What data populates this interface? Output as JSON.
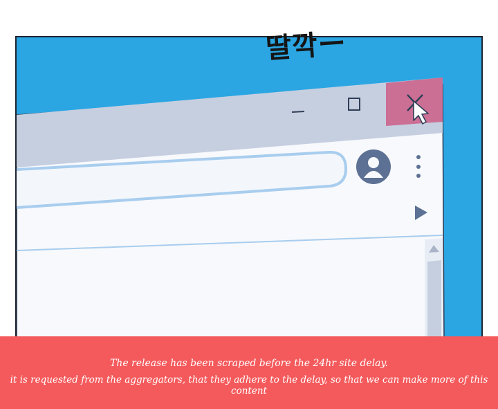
{
  "sound_effect": "딸깍ー",
  "browser": {
    "icons": {
      "minimize": "minimize-icon",
      "maximize": "maximize-icon",
      "close": "close-icon",
      "cursor": "cursor-arrow-icon",
      "profile": "profile-avatar-icon",
      "menu": "kebab-menu-icon",
      "play": "play-triangle-icon",
      "scroll_up": "scroll-up-arrow-icon"
    }
  },
  "colors": {
    "background": "#2ba6e3",
    "title_bar": "#c6cfe0",
    "close_button": "#cc6f95",
    "browser_body": "#f7f9fc",
    "address_border": "#a8cdee",
    "avatar": "#5d7194",
    "banner": "#f45a5c"
  },
  "notice": {
    "line1": "The release has been scraped before the 24hr site delay.",
    "line2": "it is requested from the aggregators, that they adhere to the delay, so that we can make more of this content"
  }
}
